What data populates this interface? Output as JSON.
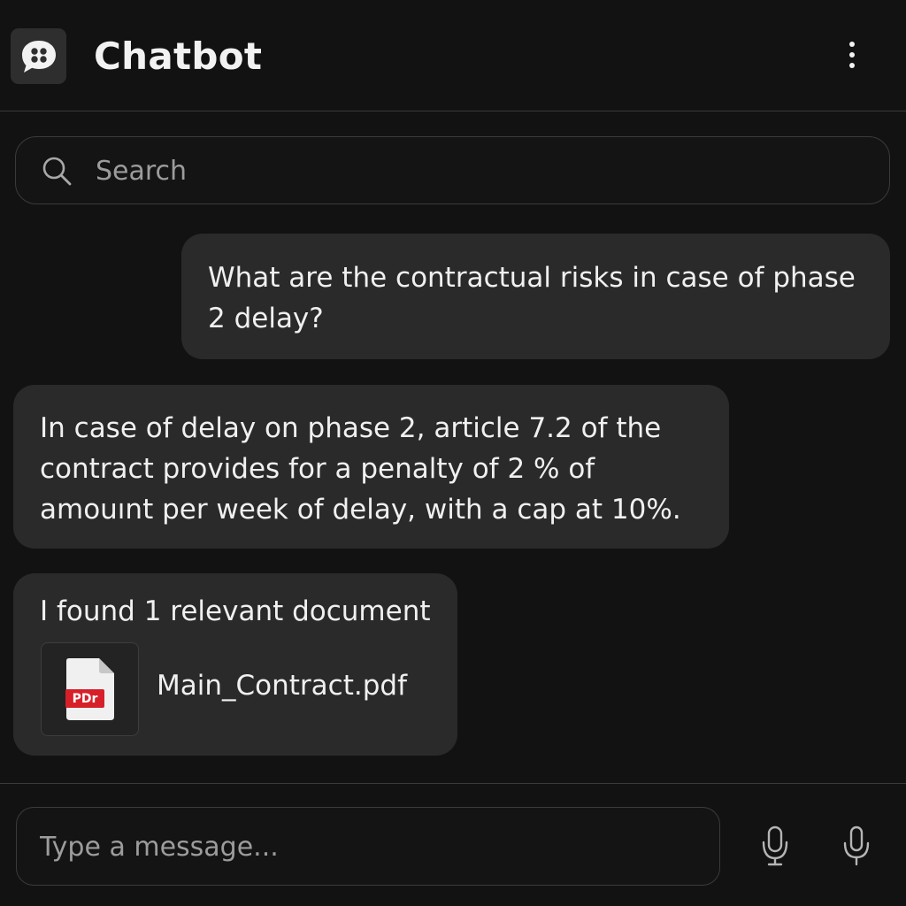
{
  "header": {
    "title": "Chatbot",
    "app_icon": "chat-bubble-icon",
    "menu_icon": "more-vertical-icon"
  },
  "search": {
    "placeholder": "Search",
    "icon": "search-icon"
  },
  "messages": [
    {
      "role": "user",
      "text": "What are the contractual risks in case of phase 2 delay?"
    },
    {
      "role": "bot",
      "text": "In case of delay on phase 2, article 7.2 of the contract provides for a penalty of 2 % of amouınt per week of delay, with a cap at 10%."
    },
    {
      "role": "bot",
      "text": "I found 1 relevant document",
      "attachment": {
        "name": "Main_Contract.pdf",
        "badge": "PDr",
        "badge_color": "#d71f2a"
      }
    }
  ],
  "composer": {
    "placeholder": "Type a message...",
    "buttons": [
      "microphone-outline-icon",
      "microphone-icon"
    ]
  },
  "colors": {
    "background": "#121212",
    "bubble": "#2a2a2a",
    "border": "#3b3b3b",
    "text": "#f0f0f0",
    "placeholder": "#9c9c9c"
  }
}
